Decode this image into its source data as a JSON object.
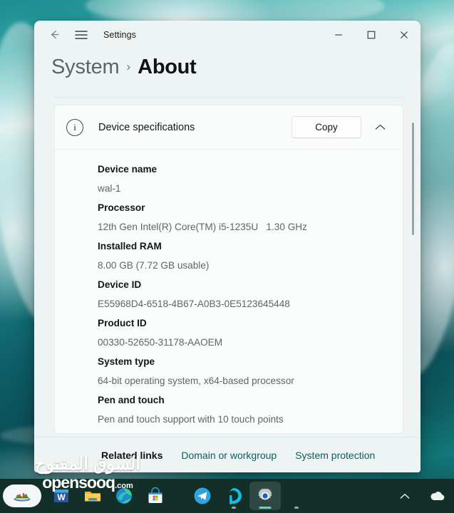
{
  "window": {
    "app_title": "Settings",
    "back_icon": "back-arrow-icon",
    "menu_icon": "hamburger-menu-icon",
    "minimize_label": "—",
    "maximize_label": "□",
    "close_label": "✕"
  },
  "breadcrumb": {
    "parent": "System",
    "separator": "›",
    "current": "About"
  },
  "card": {
    "info_icon": "info-circle-icon",
    "info_glyph": "i",
    "title": "Device specifications",
    "copy_label": "Copy",
    "collapse_icon": "chevron-up-icon"
  },
  "specs": [
    {
      "label": "Device name",
      "value": "wal-1"
    },
    {
      "label": "Processor",
      "value": "12th Gen Intel(R) Core(TM) i5-1235U   1.30 GHz"
    },
    {
      "label": "Installed RAM",
      "value": "8.00 GB (7.72 GB usable)"
    },
    {
      "label": "Device ID",
      "value": "E55968D4-6518-4B67-A0B3-0E5123645448"
    },
    {
      "label": "Product ID",
      "value": "00330-52650-31178-AAOEM"
    },
    {
      "label": "System type",
      "value": "64-bit operating system, x64-based processor"
    },
    {
      "label": "Pen and touch",
      "value": "Pen and touch support with 10 touch points"
    }
  ],
  "related": {
    "title": "Related links",
    "links": [
      {
        "label": "Domain or workgroup"
      },
      {
        "label": "System protection"
      }
    ]
  },
  "watermark": {
    "arabic": "السوق المفتوح",
    "latin": "opensooq",
    "suffix": ".com"
  },
  "taskbar": {
    "items": [
      {
        "name": "desktop-thumbnail",
        "active": false
      },
      {
        "name": "word-icon",
        "active": false
      },
      {
        "name": "file-explorer-icon",
        "active": false
      },
      {
        "name": "edge-icon",
        "active": false
      },
      {
        "name": "microsoft-store-icon",
        "active": false
      },
      {
        "name": "telegram-icon",
        "active": false
      },
      {
        "name": "alexa-icon",
        "active": false
      },
      {
        "name": "settings-icon",
        "active": true
      }
    ],
    "tray": [
      {
        "name": "show-hidden-icons-chevron-icon"
      },
      {
        "name": "onedrive-cloud-icon"
      }
    ]
  },
  "colors": {
    "window_bg": "#eef3f3",
    "card_bg": "#fbfcfc",
    "link": "#0a5e62",
    "taskbar": "#133028",
    "accent_teal": "#2aa3a3"
  }
}
